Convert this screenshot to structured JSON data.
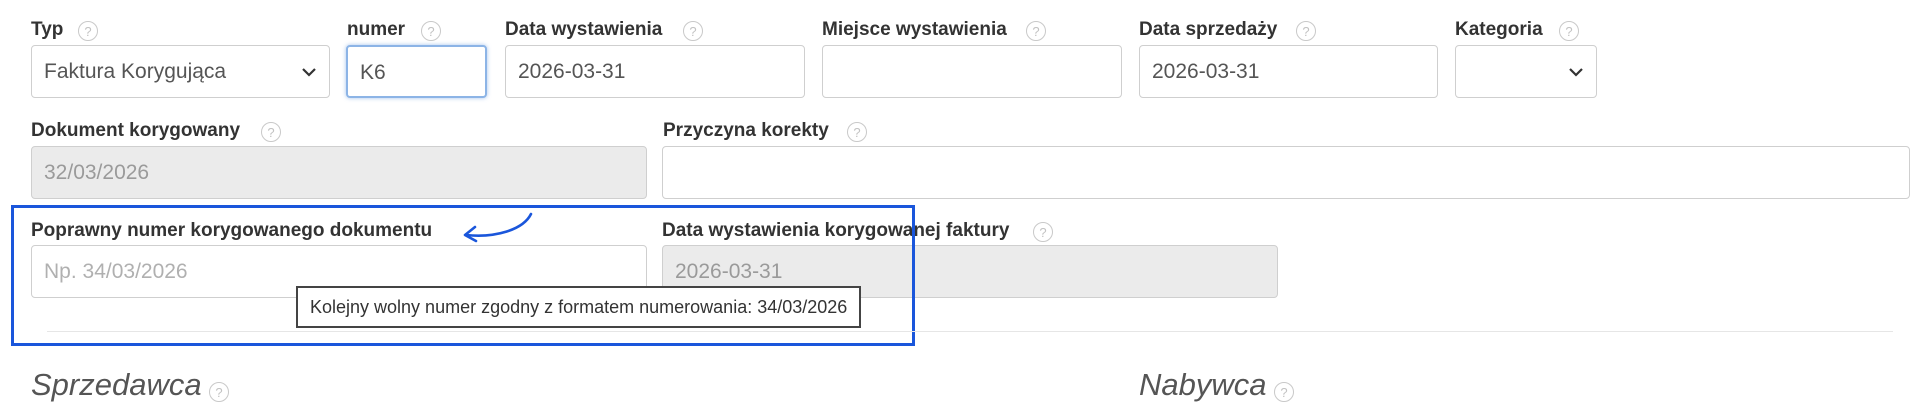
{
  "row1": {
    "typ": {
      "label": "Typ",
      "value": "Faktura Korygująca",
      "help": "?"
    },
    "numer": {
      "label": "numer",
      "value": "K6",
      "help": "?"
    },
    "data_wystawienia": {
      "label": "Data wystawienia",
      "value": "2026-03-31",
      "help": "?"
    },
    "miejsce_wystawienia": {
      "label": "Miejsce wystawienia",
      "value": "",
      "help": "?"
    },
    "data_sprzedazy": {
      "label": "Data sprzedaży",
      "value": "2026-03-31",
      "help": "?"
    },
    "kategoria": {
      "label": "Kategoria",
      "value": "",
      "help": "?"
    }
  },
  "row2": {
    "dokument_korygowany": {
      "label": "Dokument korygowany",
      "value": "32/03/2026",
      "help": "?"
    },
    "przyczyna_korekty": {
      "label": "Przyczyna korekty",
      "value": "",
      "help": "?"
    }
  },
  "row3": {
    "poprawny_numer": {
      "label": "Poprawny numer korygowanego dokumentu",
      "placeholder": "Np. 34/03/2026"
    },
    "data_wystawienia_korygowanej": {
      "label": "Data wystawienia korygowanej faktury",
      "value": "2026-03-31",
      "help": "?"
    },
    "tooltip": "Kolejny wolny numer zgodny z formatem numerowania: 34/03/2026"
  },
  "sections": {
    "sprzedawca": {
      "title": "Sprzedawca",
      "help": "?"
    },
    "nabywca": {
      "title": "Nabywca",
      "help": "?"
    }
  },
  "colors": {
    "highlight": "#1a56db",
    "focus": "#8cb4e6"
  }
}
